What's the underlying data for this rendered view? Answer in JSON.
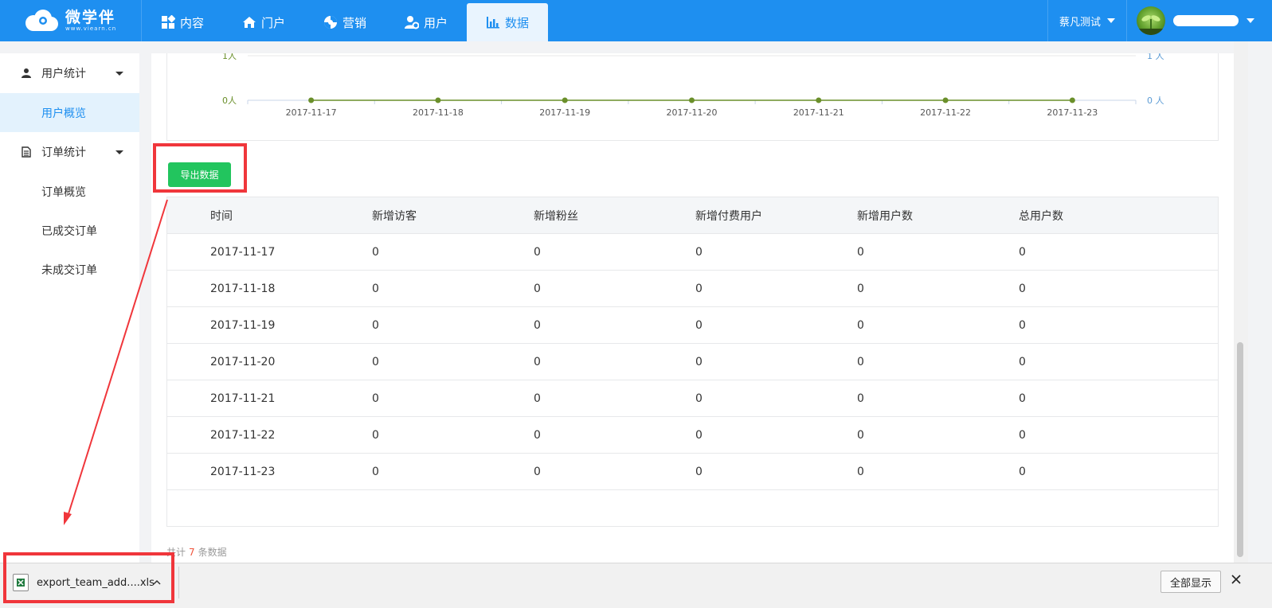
{
  "brand": {
    "name": "微学伴",
    "url": "www.viearn.cn"
  },
  "nav": [
    {
      "label": "内容",
      "icon": "grid-icon",
      "active": false
    },
    {
      "label": "门户",
      "icon": "home-icon",
      "active": false
    },
    {
      "label": "营销",
      "icon": "marketing-icon",
      "active": false
    },
    {
      "label": "用户",
      "icon": "user-gear-icon",
      "active": false
    },
    {
      "label": "数据",
      "icon": "bar-chart-icon",
      "active": true
    }
  ],
  "header": {
    "shop_name": "蔡凡测试"
  },
  "sidebar": {
    "groups": [
      {
        "label": "用户统计",
        "icon": "person-icon",
        "items": [
          {
            "label": "用户概览",
            "active": true
          }
        ]
      },
      {
        "label": "订单统计",
        "icon": "document-icon",
        "items": [
          {
            "label": "订单概览"
          },
          {
            "label": "已成交订单"
          },
          {
            "label": "未成交订单"
          }
        ]
      }
    ]
  },
  "chart_data": {
    "type": "line",
    "x": [
      "2017-11-17",
      "2017-11-18",
      "2017-11-19",
      "2017-11-20",
      "2017-11-21",
      "2017-11-22",
      "2017-11-23"
    ],
    "series": [
      {
        "values": [
          0,
          0,
          0,
          0,
          0,
          0,
          0
        ]
      }
    ],
    "y_left_ticks": [
      "0人",
      "1人"
    ],
    "y_right_ticks": [
      "0 人",
      "1 人"
    ],
    "ylim": [
      0,
      1
    ],
    "line_color": "#6a8f2a",
    "grid": true
  },
  "toolbar": {
    "export_label": "导出数据"
  },
  "table": {
    "headers": [
      "时间",
      "新增访客",
      "新增粉丝",
      "新增付费用户",
      "新增用户数",
      "总用户数"
    ],
    "rows": [
      [
        "2017-11-17",
        "0",
        "0",
        "0",
        "0",
        "0"
      ],
      [
        "2017-11-18",
        "0",
        "0",
        "0",
        "0",
        "0"
      ],
      [
        "2017-11-19",
        "0",
        "0",
        "0",
        "0",
        "0"
      ],
      [
        "2017-11-20",
        "0",
        "0",
        "0",
        "0",
        "0"
      ],
      [
        "2017-11-21",
        "0",
        "0",
        "0",
        "0",
        "0"
      ],
      [
        "2017-11-22",
        "0",
        "0",
        "0",
        "0",
        "0"
      ],
      [
        "2017-11-23",
        "0",
        "0",
        "0",
        "0",
        "0"
      ]
    ]
  },
  "footer": {
    "total_prefix": "共计",
    "total_count": "7",
    "total_suffix": "条数据"
  },
  "download_bar": {
    "file_name": "export_team_add....xls",
    "show_all_label": "全部显示"
  },
  "colors": {
    "primary": "#1e8ff0",
    "export_button": "#22c55e",
    "highlight": "#f0363b"
  }
}
